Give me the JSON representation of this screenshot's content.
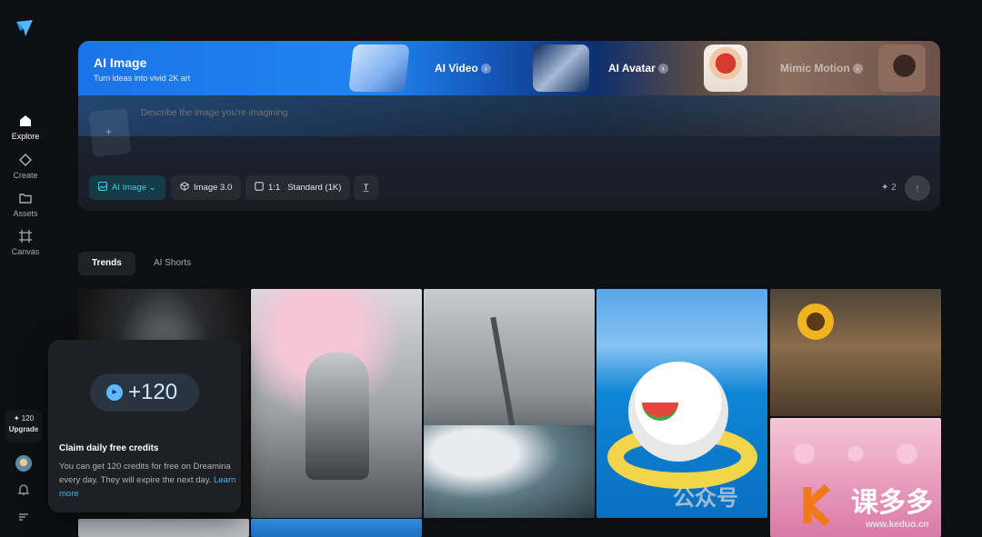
{
  "sidebar": {
    "items": [
      {
        "label": "Explore",
        "icon": "home-icon",
        "active": true
      },
      {
        "label": "Create",
        "icon": "diamond-icon"
      },
      {
        "label": "Assets",
        "icon": "folder-icon"
      },
      {
        "label": "Canvas",
        "icon": "canvas-icon"
      }
    ],
    "upgrade": {
      "credits": "✦ 120",
      "label": "Upgrade"
    }
  },
  "hero": {
    "active_tab": {
      "title": "AI Image",
      "subtitle": "Turn ideas into vivid 2K art"
    },
    "tabs": [
      {
        "label": "AI Video"
      },
      {
        "label": "AI Avatar"
      },
      {
        "label": "Mimic Motion"
      }
    ],
    "prompt_placeholder": "Describe the image you're imagining",
    "chips": {
      "model": "AI Image",
      "version": "Image 3.0",
      "ratio": "1:1",
      "quality": "Standard (1K)"
    },
    "cost": "✦ 2"
  },
  "feed_tabs": [
    {
      "label": "Trends",
      "active": true
    },
    {
      "label": "AI Shorts"
    }
  ],
  "popup": {
    "amount": "+120",
    "title": "Claim daily free credits",
    "description": "You can get 120 credits for free on Dreamina every day. They will expire the next day.",
    "link": "Learn more"
  },
  "watermark": {
    "text": "公众号",
    "brand": "课多多",
    "url": "www.keduo.cn"
  },
  "colors": {
    "accent": "#3fd1e3",
    "background": "#0e0f13",
    "hero_blue": "#1b74e8"
  }
}
